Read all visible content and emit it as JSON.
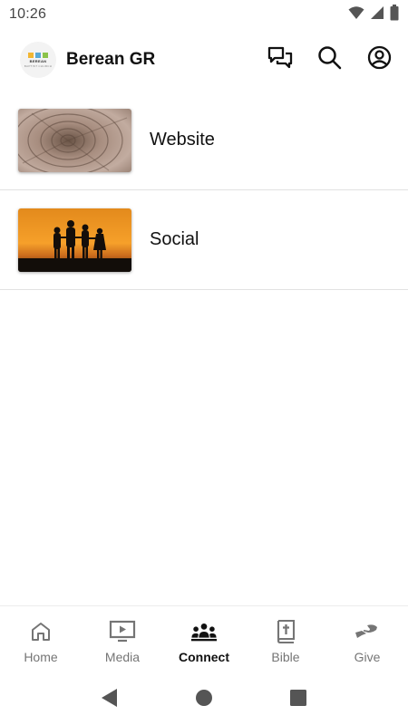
{
  "status": {
    "time": "10:26",
    "icons": [
      "wifi-icon",
      "cellular-signal-icon",
      "battery-icon"
    ]
  },
  "app_bar": {
    "title": "Berean GR",
    "logo": {
      "line1": "BEREAN",
      "line2": "BAPTIST CHURCH",
      "colors": [
        "#f2b632",
        "#5aa9d6",
        "#8bc34a"
      ]
    },
    "actions": [
      "chat-icon",
      "search-icon",
      "account-icon"
    ]
  },
  "list": {
    "items": [
      {
        "label": "Website",
        "thumbnail": "tree-rings-image"
      },
      {
        "label": "Social",
        "thumbnail": "sunset-silhouette-image"
      }
    ]
  },
  "bottom_nav": {
    "items": [
      {
        "label": "Home",
        "icon": "home-icon",
        "active": false
      },
      {
        "label": "Media",
        "icon": "tv-play-icon",
        "active": false
      },
      {
        "label": "Connect",
        "icon": "group-icon",
        "active": true
      },
      {
        "label": "Bible",
        "icon": "bible-icon",
        "active": false
      },
      {
        "label": "Give",
        "icon": "giving-hand-icon",
        "active": false
      }
    ]
  },
  "system_nav": [
    "back-icon",
    "home-circle-icon",
    "recents-icon"
  ],
  "colors": {
    "icon": "#111111",
    "inactive": "#757575",
    "divider": "#e2e2e2"
  }
}
